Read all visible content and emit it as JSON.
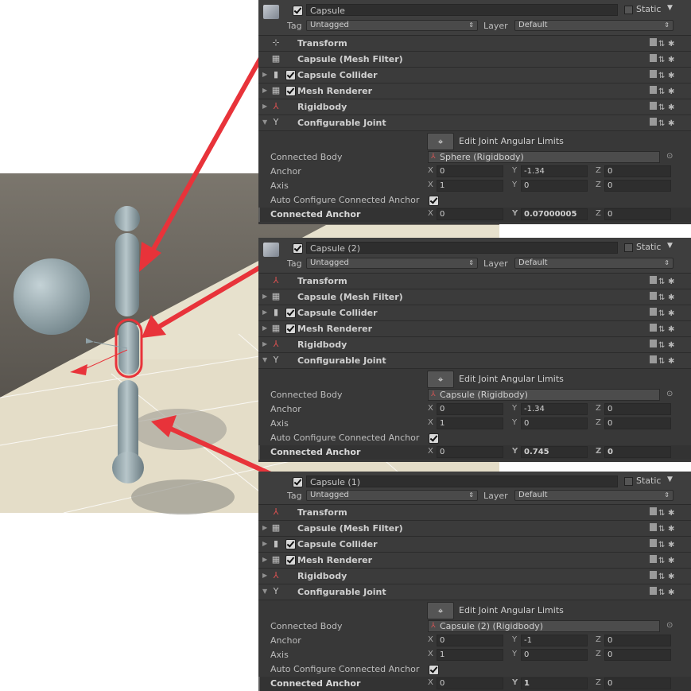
{
  "colors": {
    "arrow": "#e8333a",
    "panel_bg": "#383838",
    "ground": "#e8e2cf",
    "sky": "#5e5a54"
  },
  "panels": [
    {
      "name": "Capsule",
      "static_label": "Static",
      "tag_label": "Tag",
      "tag_value": "Untagged",
      "layer_label": "Layer",
      "layer_value": "Default",
      "components": [
        {
          "name": "Transform",
          "icon": "transform-icon",
          "check": false,
          "fold": false
        },
        {
          "name": "Capsule (Mesh Filter)",
          "icon": "mesh-filter-icon",
          "check": false,
          "fold": false
        },
        {
          "name": "Capsule Collider",
          "icon": "capsule-collider-icon",
          "check": true,
          "fold": true
        },
        {
          "name": "Mesh Renderer",
          "icon": "mesh-renderer-icon",
          "check": true,
          "fold": true
        },
        {
          "name": "Rigidbody",
          "icon": "rigidbody-icon",
          "check": false,
          "fold": true
        },
        {
          "name": "Configurable Joint",
          "icon": "joint-icon",
          "check": false,
          "fold": true,
          "open": true
        }
      ],
      "edit_label": "Edit Joint Angular Limits",
      "connected_body_label": "Connected Body",
      "connected_body": "Sphere (Rigidbody)",
      "anchor_label": "Anchor",
      "anchor": {
        "x": "0",
        "y": "-1.34",
        "z": "0"
      },
      "axis_label": "Axis",
      "axis": {
        "x": "1",
        "y": "0",
        "z": "0"
      },
      "auto_label": "Auto Configure Connected Anchor",
      "connected_anchor_label": "Connected Anchor",
      "connected_anchor": {
        "x": "0",
        "y": "0.07000005",
        "z": "0"
      },
      "bold_axis": "y"
    },
    {
      "name": "Capsule (2)",
      "static_label": "Static",
      "tag_label": "Tag",
      "tag_value": "Untagged",
      "layer_label": "Layer",
      "layer_value": "Default",
      "components": [
        {
          "name": "Transform",
          "icon": "transform-icon",
          "check": false,
          "fold": false
        },
        {
          "name": "Capsule (Mesh Filter)",
          "icon": "mesh-filter-icon",
          "check": false,
          "fold": false
        },
        {
          "name": "Capsule Collider",
          "icon": "capsule-collider-icon",
          "check": true,
          "fold": true
        },
        {
          "name": "Mesh Renderer",
          "icon": "mesh-renderer-icon",
          "check": true,
          "fold": true
        },
        {
          "name": "Rigidbody",
          "icon": "rigidbody-icon",
          "check": false,
          "fold": true
        },
        {
          "name": "Configurable Joint",
          "icon": "joint-icon",
          "check": false,
          "fold": true,
          "open": true
        }
      ],
      "edit_label": "Edit Joint Angular Limits",
      "connected_body_label": "Connected Body",
      "connected_body": "Capsule (Rigidbody)",
      "anchor_label": "Anchor",
      "anchor": {
        "x": "0",
        "y": "-1.34",
        "z": "0"
      },
      "axis_label": "Axis",
      "axis": {
        "x": "1",
        "y": "0",
        "z": "0"
      },
      "auto_label": "Auto Configure Connected Anchor",
      "connected_anchor_label": "Connected Anchor",
      "connected_anchor": {
        "x": "0",
        "y": "0.745",
        "z": "0"
      },
      "bold_axis": "yz"
    },
    {
      "name": "Capsule (1)",
      "static_label": "Static",
      "tag_label": "Tag",
      "tag_value": "Untagged",
      "layer_label": "Layer",
      "layer_value": "Default",
      "components": [
        {
          "name": "Transform",
          "icon": "transform-icon",
          "check": false,
          "fold": false
        },
        {
          "name": "Capsule (Mesh Filter)",
          "icon": "mesh-filter-icon",
          "check": false,
          "fold": false
        },
        {
          "name": "Capsule Collider",
          "icon": "capsule-collider-icon",
          "check": true,
          "fold": true
        },
        {
          "name": "Mesh Renderer",
          "icon": "mesh-renderer-icon",
          "check": true,
          "fold": true
        },
        {
          "name": "Rigidbody",
          "icon": "rigidbody-icon",
          "check": false,
          "fold": true
        },
        {
          "name": "Configurable Joint",
          "icon": "joint-icon",
          "check": false,
          "fold": true,
          "open": true
        }
      ],
      "edit_label": "Edit Joint Angular Limits",
      "connected_body_label": "Connected Body",
      "connected_body": "Capsule (2) (Rigidbody)",
      "anchor_label": "Anchor",
      "anchor": {
        "x": "0",
        "y": "-1",
        "z": "0"
      },
      "axis_label": "Axis",
      "axis": {
        "x": "1",
        "y": "0",
        "z": "0"
      },
      "auto_label": "Auto Configure Connected Anchor",
      "connected_anchor_label": "Connected Anchor",
      "connected_anchor": {
        "x": "0",
        "y": "1",
        "z": "0"
      },
      "bold_axis": "y"
    }
  ]
}
